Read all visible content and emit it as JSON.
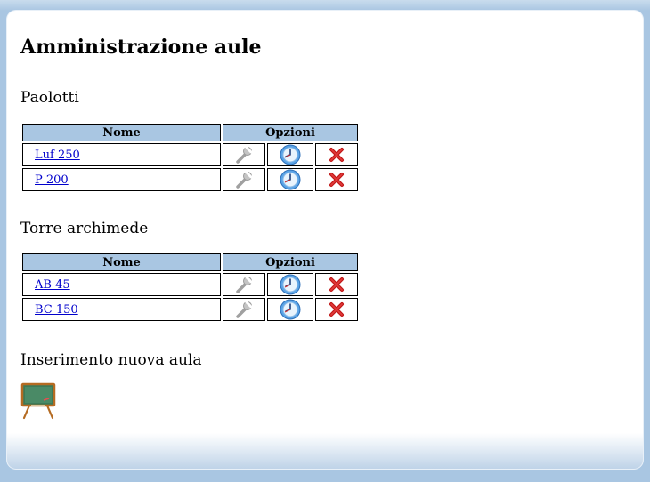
{
  "page": {
    "title": "Amministrazione aule"
  },
  "buildings": [
    {
      "name": "Paolotti",
      "headers": {
        "nome": "Nome",
        "opzioni": "Opzioni"
      },
      "rooms": [
        {
          "name": "Luf 250"
        },
        {
          "name": "P 200"
        }
      ]
    },
    {
      "name": "Torre archimede",
      "headers": {
        "nome": "Nome",
        "opzioni": "Opzioni"
      },
      "rooms": [
        {
          "name": "AB 45"
        },
        {
          "name": "BC 150"
        }
      ]
    }
  ],
  "new_room": {
    "title": "Inserimento nuova aula",
    "icon": "blackboard-icon"
  },
  "icons": {
    "edit": "wrench-icon",
    "schedule": "clock-icon",
    "delete": "delete-x-icon"
  },
  "colors": {
    "background": "#a9c6e2",
    "header_bg": "#a9c6e2",
    "link": "#0000cc",
    "delete": "#cc1a1a"
  }
}
